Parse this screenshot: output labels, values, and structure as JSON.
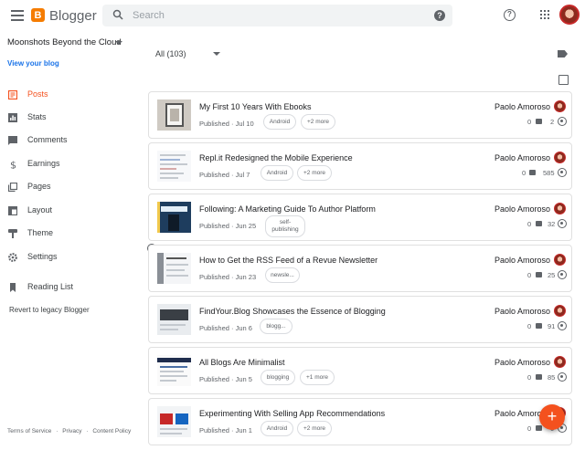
{
  "app": {
    "title": "Blogger",
    "logo_letter": "B"
  },
  "search": {
    "placeholder": "Search",
    "help": "?"
  },
  "header": {
    "help": "?"
  },
  "sidebar": {
    "blog_name": "Moonshots Beyond the Cloud",
    "view_blog": "View your blog",
    "items": [
      {
        "label": "Posts",
        "icon": "posts-icon"
      },
      {
        "label": "Stats",
        "icon": "stats-icon"
      },
      {
        "label": "Comments",
        "icon": "comments-icon"
      },
      {
        "label": "Earnings",
        "icon": "earnings-icon"
      },
      {
        "label": "Pages",
        "icon": "pages-icon"
      },
      {
        "label": "Layout",
        "icon": "layout-icon"
      },
      {
        "label": "Theme",
        "icon": "theme-icon"
      },
      {
        "label": "Settings",
        "icon": "settings-icon"
      },
      {
        "label": "Reading List",
        "icon": "reading-list-icon"
      },
      {
        "label": "Revert to legacy Blogger",
        "icon": ""
      }
    ],
    "footer": [
      "Terms of Service",
      "·",
      "Privacy",
      "·",
      "Content Policy"
    ]
  },
  "main": {
    "filter": "All (103)",
    "posts": [
      {
        "title": "My First 10 Years With Ebooks",
        "status": "Published · Jul 10",
        "chips": [
          "Android",
          "+2 more"
        ],
        "author": "Paolo Amoroso",
        "comments": "0",
        "views": "2"
      },
      {
        "title": "Repl.it Redesigned the Mobile Experience",
        "status": "Published · Jul 7",
        "chips": [
          "Android",
          "+2 more"
        ],
        "author": "Paolo Amoroso",
        "comments": "0",
        "views": "585"
      },
      {
        "title": "Following: A Marketing Guide To Author Platform",
        "status": "Published · Jun 25",
        "chips": [
          "self-publishing"
        ],
        "author": "Paolo Amoroso",
        "comments": "0",
        "views": "32"
      },
      {
        "title": "How to Get the RSS Feed of a Revue Newsletter",
        "status": "Published · Jun 23",
        "chips": [
          "newsle..."
        ],
        "author": "Paolo Amoroso",
        "comments": "0",
        "views": "25"
      },
      {
        "title": "FindYour.Blog Showcases the Essence of Blogging",
        "status": "Published · Jun 6",
        "chips": [
          "blogg..."
        ],
        "author": "Paolo Amoroso",
        "comments": "0",
        "views": "91"
      },
      {
        "title": "All Blogs Are Minimalist",
        "status": "Published · Jun 5",
        "chips": [
          "blogging",
          "+1 more"
        ],
        "author": "Paolo Amoroso",
        "comments": "0",
        "views": "85"
      },
      {
        "title": "Experimenting With Selling App Recommendations",
        "status": "Published · Jun 1",
        "chips": [
          "Android",
          "+2 more"
        ],
        "author": "Paolo Amoroso",
        "comments": "0",
        "views": "0"
      }
    ]
  },
  "fab": {
    "label": "+"
  },
  "colors": {
    "accent": "#f4511e",
    "brand": "#f57c00",
    "link": "#1a73e8"
  }
}
